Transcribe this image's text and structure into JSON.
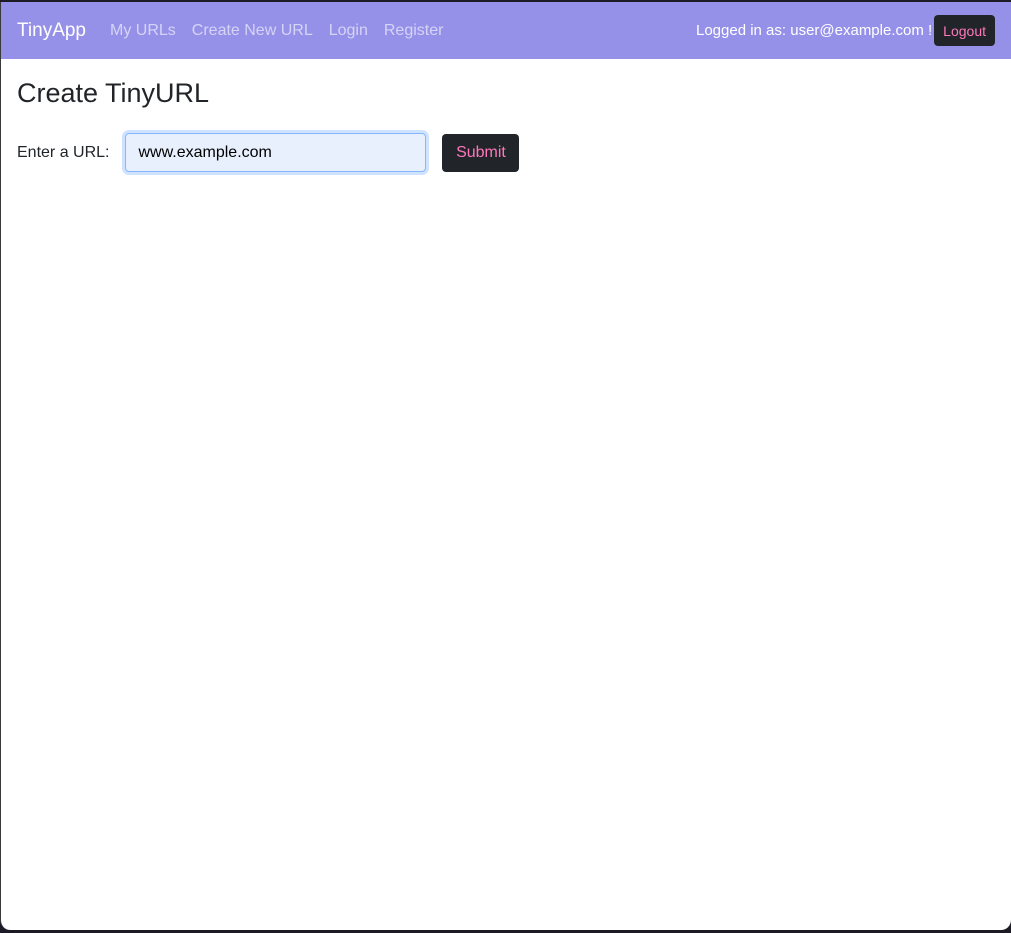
{
  "navbar": {
    "brand": "TinyApp",
    "links": [
      {
        "label": "My URLs"
      },
      {
        "label": "Create New URL"
      },
      {
        "label": "Login"
      },
      {
        "label": "Register"
      }
    ],
    "logged_in_text": "Logged in as: user@example.com !",
    "logout_label": "Logout"
  },
  "main": {
    "title": "Create TinyURL",
    "form": {
      "url_label": "Enter a URL:",
      "url_value": "www.example.com",
      "submit_label": "Submit"
    }
  },
  "colors": {
    "navbar_bg": "#9691e8",
    "button_bg": "#212529",
    "button_text": "#ff77bb",
    "input_bg": "#e8f0fe"
  }
}
